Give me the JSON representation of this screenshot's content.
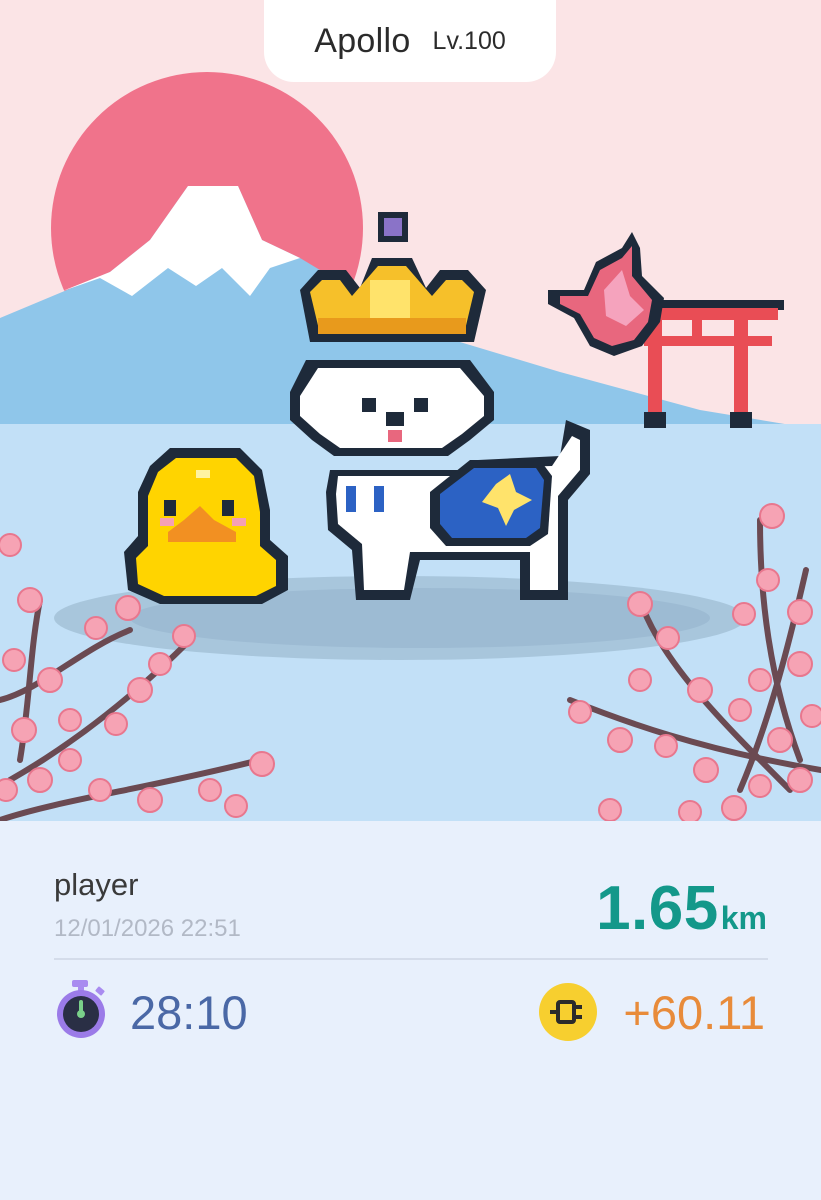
{
  "pet": {
    "name": "Apollo",
    "level": "Lv.100"
  },
  "scene": {
    "icons": [
      "mount-fuji",
      "rising-sun",
      "torii-gate",
      "cherry-blossom-branch",
      "crowned-dog-character",
      "yellow-chick-companion",
      "pink-bird-companion"
    ]
  },
  "record": {
    "player": "player",
    "timestamp": "12/01/2026 22:51",
    "distance_value": "1.65",
    "distance_unit": "km",
    "duration": "28:10",
    "reward": "+60.11"
  },
  "icons": {
    "timer": "stopwatch-icon",
    "reward": "fuel-plug-icon"
  },
  "colors": {
    "sky": "#fbe4e6",
    "sun": "#f0738b",
    "ground": "#c2e0f7",
    "panel": "#e8f0fc",
    "distance": "#13988a",
    "duration": "#4a68a6",
    "reward": "#e88b3a"
  }
}
